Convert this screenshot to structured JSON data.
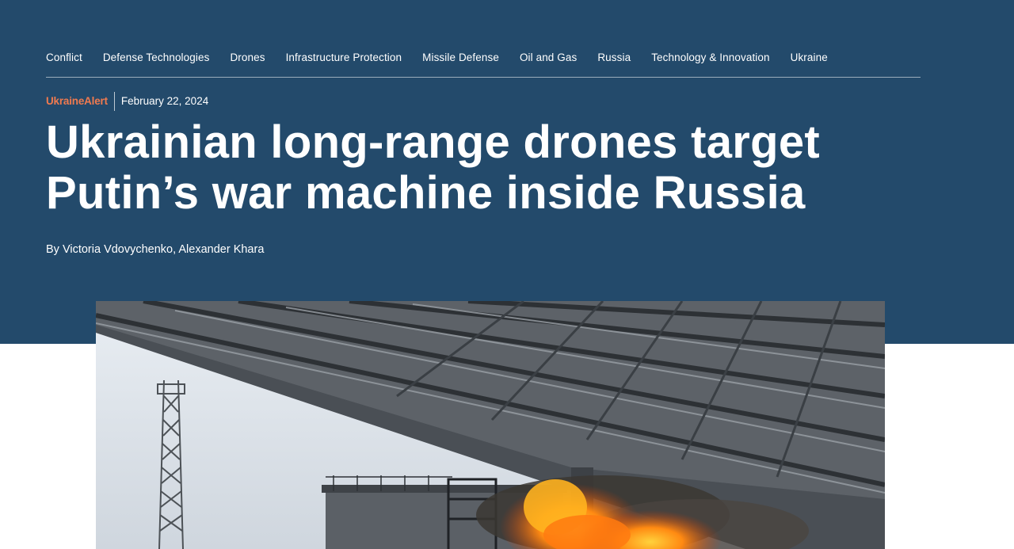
{
  "nav": {
    "items": [
      {
        "label": "Conflict"
      },
      {
        "label": "Defense Technologies"
      },
      {
        "label": "Drones"
      },
      {
        "label": "Infrastructure Protection"
      },
      {
        "label": "Missile Defense"
      },
      {
        "label": "Oil and Gas"
      },
      {
        "label": "Russia"
      },
      {
        "label": "Technology & Innovation"
      },
      {
        "label": "Ukraine"
      }
    ]
  },
  "article": {
    "category": "UkraineAlert",
    "date": "February 22, 2024",
    "headline": "Ukrainian long-range drones target Putin’s war machine inside Russia",
    "byline": "By Victoria Vdovychenko, Alexander Khara"
  },
  "colors": {
    "hero_bg": "#234a6b",
    "category_accent": "#f07a4f",
    "text": "#ffffff"
  }
}
